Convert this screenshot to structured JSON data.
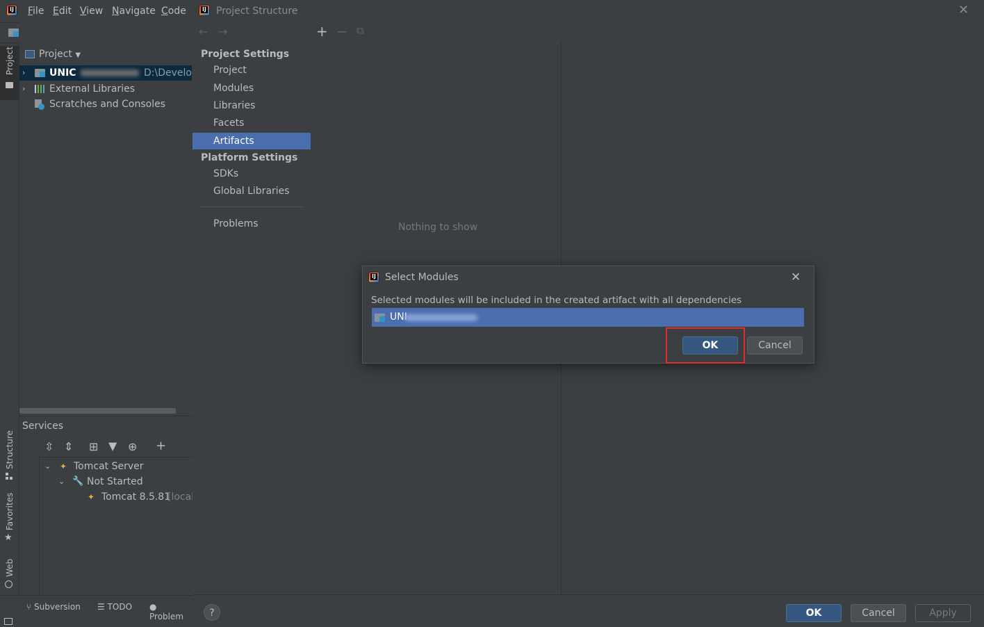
{
  "menu": {
    "items": [
      "File",
      "Edit",
      "View",
      "Navigate",
      "Code"
    ],
    "mnemonics": [
      "F",
      "E",
      "V",
      "N",
      "C"
    ]
  },
  "project_header": {
    "prefix": "UN"
  },
  "project_panel": {
    "selector_label": "Project",
    "tree": [
      {
        "label": "UNIC",
        "suffix": "D:\\Develop"
      },
      {
        "label": "External Libraries"
      },
      {
        "label": "Scratches and Consoles"
      }
    ]
  },
  "side_tabs": {
    "project": "Project",
    "structure": "Structure",
    "favorites": "Favorites",
    "web": "Web"
  },
  "services": {
    "title": "Services",
    "tree": [
      {
        "label": "Tomcat Server"
      },
      {
        "label": "Not Started"
      },
      {
        "label": "Tomcat 8.5.81",
        "suffix": "[local"
      }
    ]
  },
  "bottom_tabs": [
    "Subversion",
    "TODO",
    "Problem"
  ],
  "project_structure": {
    "title": "Project Structure",
    "project_settings_header": "Project Settings",
    "project_settings_items": [
      "Project",
      "Modules",
      "Libraries",
      "Facets",
      "Artifacts"
    ],
    "platform_settings_header": "Platform Settings",
    "platform_settings_items": [
      "SDKs",
      "Global Libraries"
    ],
    "problems": "Problems",
    "empty_text": "Nothing to show",
    "footer": {
      "ok": "OK",
      "cancel": "Cancel",
      "apply": "Apply",
      "help": "?"
    }
  },
  "select_modules": {
    "title": "Select Modules",
    "description": "Selected modules will be included in the created artifact with all dependencies",
    "module_prefix": "UNI",
    "ok": "OK",
    "cancel": "Cancel"
  },
  "colors": {
    "background": "#3c3f41",
    "selection": "#4b6eaf",
    "primary_button": "#365880",
    "highlight_box": "#e0302c"
  }
}
